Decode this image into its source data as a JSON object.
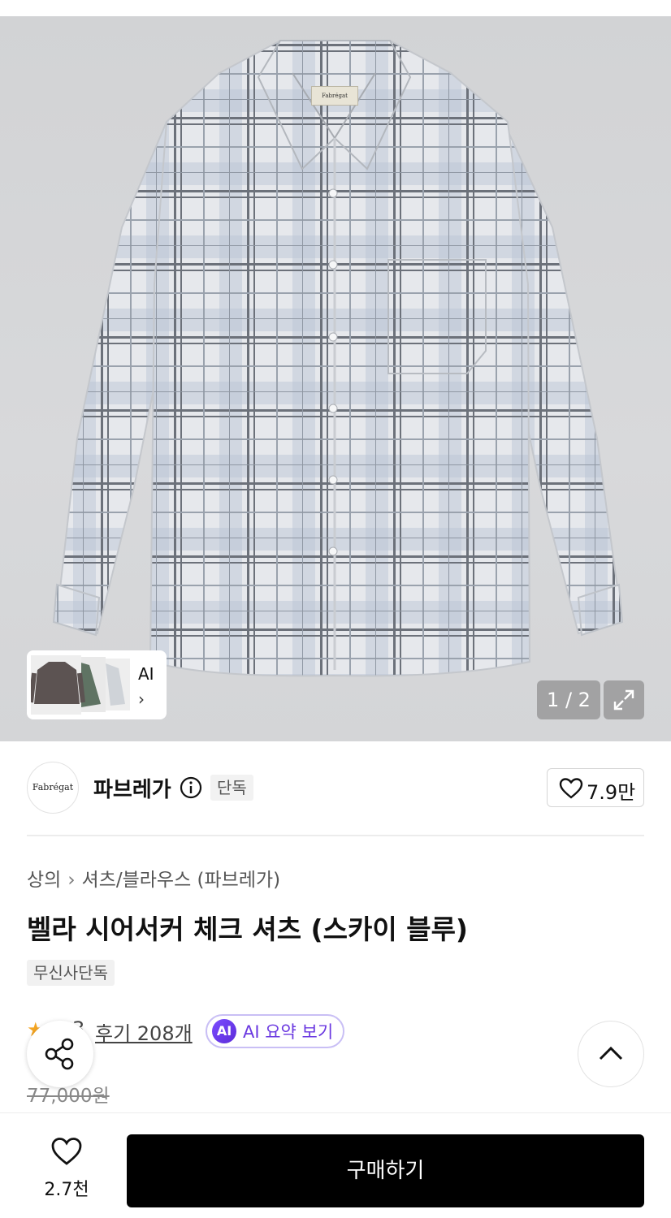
{
  "gallery": {
    "ai_label": "AI",
    "ai_chevron": "›",
    "page_indicator": "1 / 2",
    "shirt_brand_tag": "Fabrégat",
    "icons": [
      "expand-icon",
      "chevron-right-icon"
    ]
  },
  "brand": {
    "logo_text": "Fabrégat",
    "name": "파브레가",
    "badge": "단독",
    "like_count": "7.9만",
    "icons": [
      "info-icon",
      "heart-icon"
    ]
  },
  "product": {
    "breadcrumb": [
      "상의",
      "셔츠/블라우스 (파브레가)"
    ],
    "breadcrumb_sep": "›",
    "title": "벨라 시어서커 체크 셔츠 (스카이 블루)",
    "tag": "무신사단독",
    "rating_partial": "3",
    "reviews_link": "후기 208개",
    "ai_summary_badge": "AI",
    "ai_summary_label": "AI 요약 보기",
    "original_price": "77,000원"
  },
  "floating": {
    "icons": [
      "share-icon",
      "chevron-up-icon"
    ]
  },
  "bottom_bar": {
    "like_count": "2.7천",
    "buy_label": "구매하기"
  },
  "colors": {
    "accent_purple": "#6a38e0",
    "buy_button": "#000000",
    "star": "#f5a623"
  }
}
